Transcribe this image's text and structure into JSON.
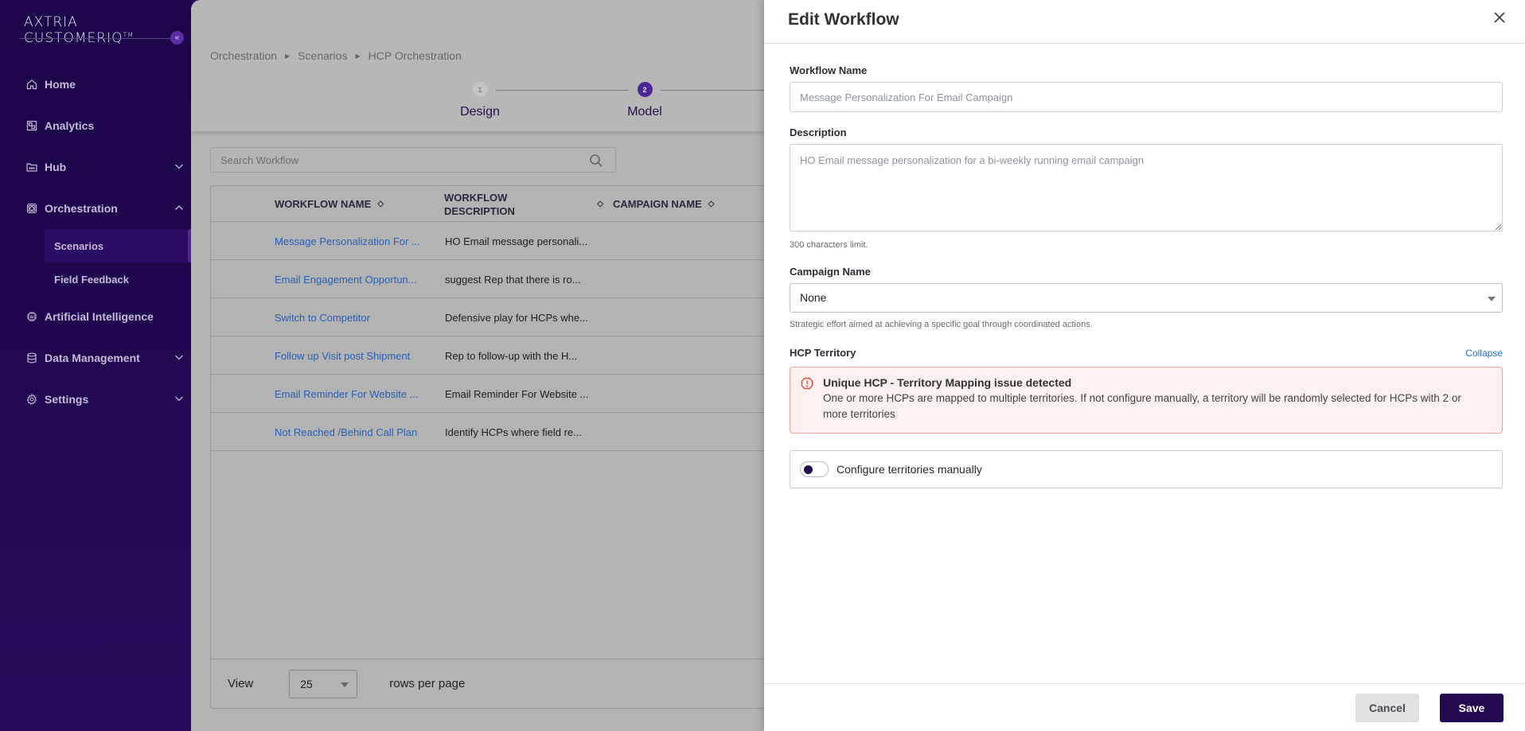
{
  "app": {
    "logo_text": "AXTRIA CUSTOMERIQ",
    "logo_tm": "TM",
    "collapse_icon": "double-chevron-left-icon"
  },
  "sidebar": {
    "items": [
      {
        "label": "Home",
        "icon": "home-icon",
        "expandable": false
      },
      {
        "label": "Analytics",
        "icon": "analytics-icon",
        "expandable": false
      },
      {
        "label": "Hub",
        "icon": "folder-icon",
        "expandable": true,
        "expanded": false
      },
      {
        "label": "Orchestration",
        "icon": "orchestration-icon",
        "expandable": true,
        "expanded": true,
        "children": [
          {
            "label": "Scenarios",
            "active": true
          },
          {
            "label": "Field Feedback",
            "active": false
          }
        ]
      },
      {
        "label": "Artificial Intelligence",
        "icon": "ai-chip-icon",
        "expandable": false
      },
      {
        "label": "Data Management",
        "icon": "database-icon",
        "expandable": true,
        "expanded": false
      },
      {
        "label": "Settings",
        "icon": "gear-icon",
        "expandable": true,
        "expanded": false
      }
    ]
  },
  "breadcrumb": [
    "Orchestration",
    "Scenarios",
    "HCP Orchestration"
  ],
  "stepper": {
    "steps": [
      {
        "number": "1",
        "label": "Design",
        "state": "completed"
      },
      {
        "number": "2",
        "label": "Model",
        "state": "active"
      }
    ]
  },
  "search": {
    "placeholder": "Search Workflow",
    "value": ""
  },
  "table": {
    "columns": [
      "WORKFLOW NAME",
      "WORKFLOW DESCRIPTION",
      "CAMPAIGN NAME"
    ],
    "rows": [
      {
        "name": "Message Personalization For ...",
        "description": "HO Email message personali..."
      },
      {
        "name": "Email Engagement Opportun...",
        "description": "suggest Rep that there is ro..."
      },
      {
        "name": "Switch to Competitor",
        "description": "Defensive play for HCPs whe..."
      },
      {
        "name": "Follow up Visit post Shipment",
        "description": "Rep to follow-up with the H..."
      },
      {
        "name": "Email Reminder For Website ...",
        "description": "Email Reminder For Website ..."
      },
      {
        "name": "Not Reached /Behind Call Plan",
        "description": "Identify HCPs where field re..."
      }
    ],
    "footer": {
      "view_label": "View",
      "rows_per_page": "25",
      "rows_per_page_label": "rows per page"
    }
  },
  "drawer": {
    "title": "Edit Workflow",
    "workflow_name_label": "Workflow Name",
    "workflow_name_value": "Message Personalization For Email Campaign",
    "description_label": "Description",
    "description_value": "HO Email message personalization for a bi-weekly running email campaign",
    "description_hint": "300 characters limit.",
    "campaign_label": "Campaign Name",
    "campaign_value": "None",
    "campaign_hint": "Strategic effort aimed at achieving a specific goal through coordinated actions.",
    "territory_label": "HCP Territory",
    "collapse_label": "Collapse",
    "alert_title": "Unique HCP - Territory Mapping issue detected",
    "alert_message": "One or more HCPs are mapped to multiple territories. If not configure manually, a territory will be randomly selected for HCPs with 2 or more territories",
    "toggle_label": "Configure territories manually",
    "toggle_on": false,
    "cancel_label": "Cancel",
    "save_label": "Save"
  },
  "colors": {
    "sidebar_bg": "#1c0548",
    "accent": "#23094f",
    "step_active": "#5a2ea6",
    "link": "#1f6fd1",
    "alert_bg": "#fdf0f0",
    "alert_border": "#f2a49e",
    "alert_icon": "#e5483c"
  }
}
